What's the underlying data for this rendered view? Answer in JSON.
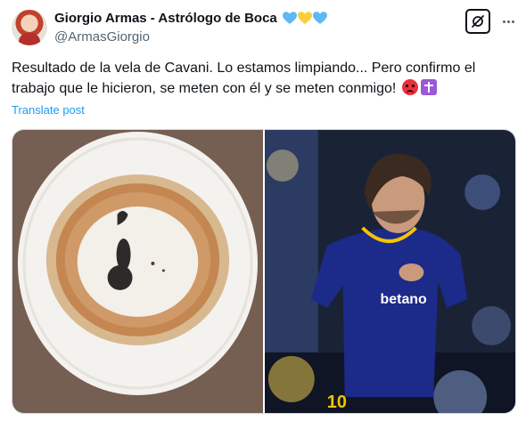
{
  "post": {
    "author_name": "Giorgio Armas - Astrólogo de Boca",
    "author_handle": "@ArmasGiorgio",
    "heart_colors": [
      "#5db8f5",
      "#f9cf3c",
      "#5db8f5"
    ],
    "text": "Resultado de la vela de Cavani. Lo estamos limpiando... Pero confirmo el trabajo que le hicieron, se meten con él y se meten conmigo!",
    "translate_label": "Translate post",
    "emojis": [
      "angry-face-icon",
      "latin-cross-icon"
    ],
    "media": [
      {
        "icon": "candle-wax-plate-image"
      },
      {
        "icon": "football-player-image",
        "shirt_text": "betano",
        "shirt_number": "10"
      }
    ]
  },
  "colors": {
    "link": "#1d9bf0",
    "secondary_text": "#536471",
    "jersey": "#1c2a8a",
    "jersey_accent": "#f3c400"
  }
}
